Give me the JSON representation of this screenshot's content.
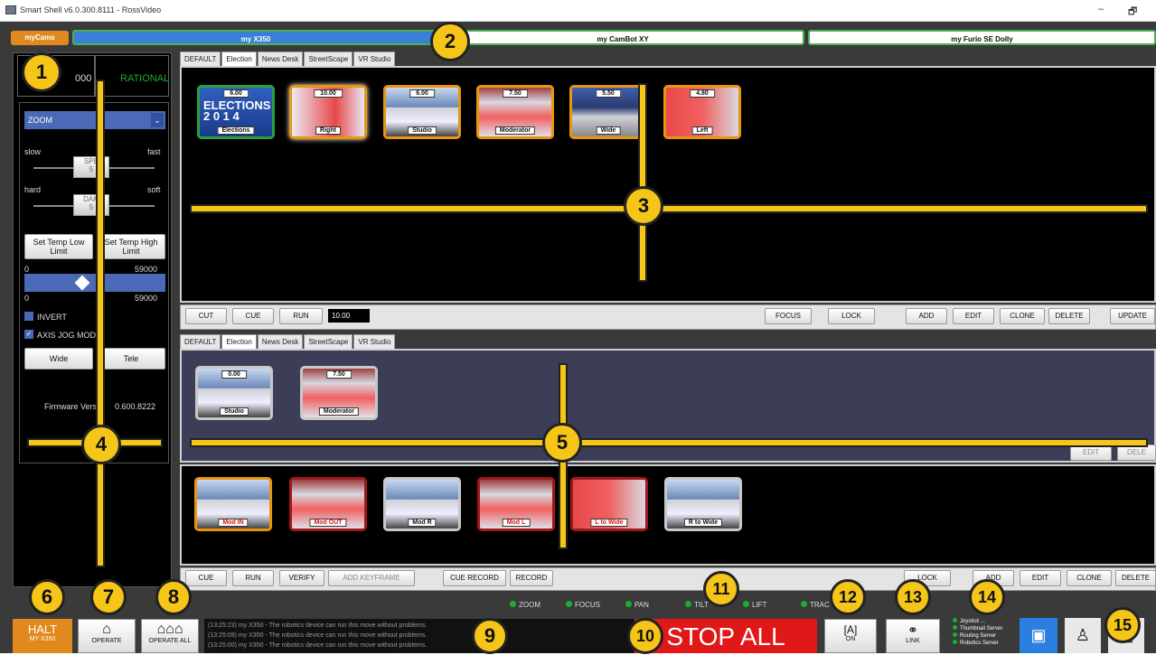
{
  "window": {
    "title": "Smart Shell v6.0.300.8111 - RossVideo",
    "min": "–",
    "restore": "🗗"
  },
  "header": {
    "mycams_label": "myCams",
    "cams": [
      {
        "label": "my X350",
        "color": "#3a7fd6"
      },
      {
        "label": "my CamBot XY",
        "color": "#ffffff"
      },
      {
        "label": "my Furio SE Dolly",
        "color": "#ffffff"
      }
    ]
  },
  "left_panel": {
    "top_left_value": "000",
    "top_right_status": "RATIONAL",
    "mode_select": "ZOOM",
    "speed": {
      "slow": "slow",
      "fast": "fast",
      "label": "SPE",
      "value": "5"
    },
    "damp": {
      "hard": "hard",
      "soft": "soft",
      "label": "DAM",
      "value": "5"
    },
    "set_temp_low": "Set Temp Low Limit",
    "set_temp_high": "Set Temp High Limit",
    "range_min": "0",
    "range_max": "59000",
    "range_min2": "0",
    "range_max2": "59000",
    "invert": "INVERT",
    "axis_jog": "AXIS JOG MODE",
    "wide": "Wide",
    "tele": "Tele",
    "firmware": "Firmware Versi",
    "firmware_value": "0.600.8222"
  },
  "top_tabs": [
    "DEFAULT",
    "Election",
    "News Desk",
    "StreetScape",
    "VR Studio"
  ],
  "shots": [
    {
      "value": "6.00",
      "name": "Elections"
    },
    {
      "value": "10.00",
      "name": "Right"
    },
    {
      "value": "6.00",
      "name": "Studio"
    },
    {
      "value": "7.50",
      "name": "Moderator"
    },
    {
      "value": "5.50",
      "name": "Wide"
    },
    {
      "value": "4.80",
      "name": "Left"
    }
  ],
  "shot_toolbar": {
    "cut": "CUT",
    "cue": "CUE",
    "run": "RUN",
    "time": "10.00",
    "focus": "FOCUS",
    "lock": "LOCK",
    "add": "ADD",
    "edit": "EDIT",
    "clone": "CLONE",
    "delete": "DELETE",
    "update": "UPDATE"
  },
  "bottom_tabs": [
    "DEFAULT",
    "Election",
    "News Desk",
    "StreetScape",
    "VR Studio"
  ],
  "seq_shots": [
    {
      "value": "0.00",
      "name": "Studio"
    },
    {
      "value": "7.50",
      "name": "Moderator"
    }
  ],
  "seq_panel_buttons": {
    "edit": "EDIT",
    "delete": "DELE"
  },
  "moves": [
    {
      "name": "Mod IN"
    },
    {
      "name": "Mod OUT"
    },
    {
      "name": "Mod R"
    },
    {
      "name": "Mod L"
    },
    {
      "name": "L to Wide"
    },
    {
      "name": "R to Wide"
    }
  ],
  "move_toolbar": {
    "cue": "CUE",
    "run": "RUN",
    "verify": "VERIFY",
    "add_keyframe": "ADD KEYFRAME",
    "cue_record": "CUE RECORD",
    "record": "RECORD",
    "lock": "LOCK",
    "add": "ADD",
    "edit": "EDIT",
    "clone": "CLONE",
    "delete": "DELETE"
  },
  "status_lights": [
    "ZOOM",
    "FOCUS",
    "PAN",
    "TILT",
    "LIFT",
    "TRAC"
  ],
  "log": [
    "(13:25:23) my X350 - The robotics device can run this move without problems.",
    "(13:25:09) my X350 - The robotics device can run this move without problems.",
    "(13:25:00) my X350 - The robotics device can run this move without problems."
  ],
  "footer": {
    "halt": "HALT",
    "halt_sub": "MY X350",
    "operate": "OPERATE",
    "operate_all": "OPERATE ALL",
    "stop_all": "STOP ALL",
    "auto_on": "ON",
    "link": "LINK",
    "servers": [
      "Joystick ...",
      "Thumbnail Server",
      "Routing Server",
      "Robotics Server"
    ]
  },
  "callouts": [
    "1",
    "2",
    "3",
    "4",
    "5",
    "6",
    "7",
    "8",
    "9",
    "10",
    "11",
    "12",
    "13",
    "14",
    "15"
  ]
}
